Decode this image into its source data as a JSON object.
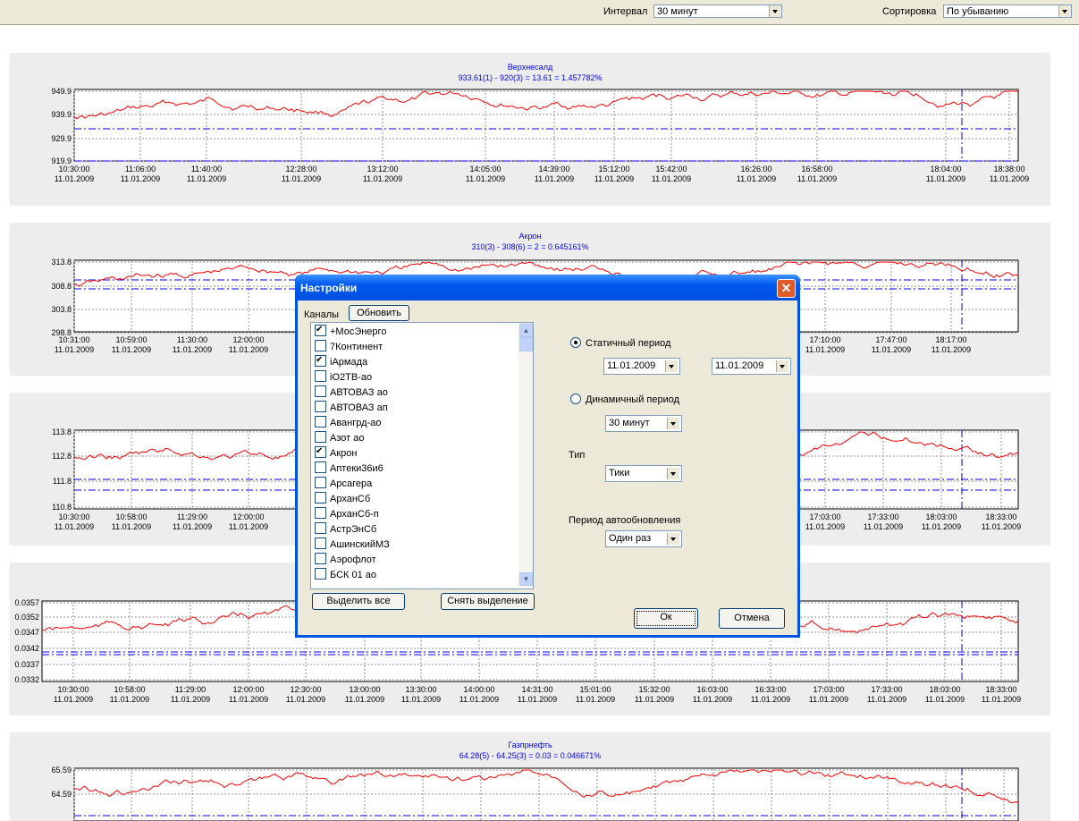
{
  "toolbar": {
    "interval_label": "Интервал",
    "interval_value": "30 минут",
    "sort_label": "Сортировка",
    "sort_value": "По убыванию"
  },
  "charts": [
    {
      "title": "Верхнесалд",
      "subtitle": "933.61(1) - 920(3) = 13.61 = 1.457782%",
      "yticks": [
        "949.9",
        "939.9",
        "929.9",
        "919.9"
      ],
      "xticks": [
        [
          "10:30:00",
          "11.01.2009"
        ],
        [
          "11:06:00",
          "11.01.2009"
        ],
        [
          "11:40:00",
          "11.01.2009"
        ],
        [
          "12:28:00",
          "11.01.2009"
        ],
        [
          "13:12:00",
          "11.01.2009"
        ],
        [
          "14:05:00",
          "11.01.2009"
        ],
        [
          "14:39:00",
          "11.01.2009"
        ],
        [
          "15:12:00",
          "11.01.2009"
        ],
        [
          "15:42:00",
          "11.01.2009"
        ],
        [
          "16:26:00",
          "11.01.2009"
        ],
        [
          "16:58:00",
          "11.01.2009"
        ],
        [
          "18:04:00",
          "11.01.2009"
        ],
        [
          "18:38:00",
          "11.01.2009"
        ]
      ]
    },
    {
      "title": "Акрон",
      "subtitle": "310(3) - 308(6) = 2 = 0.645161%",
      "yticks": [
        "313.8",
        "308.8",
        "303.8",
        "298.8"
      ],
      "xticks": [
        [
          "10:31:00",
          "11.01.2009"
        ],
        [
          "10:59:00",
          "11.01.2009"
        ],
        [
          "11:30:00",
          "11.01.2009"
        ],
        [
          "12:00:00",
          "11.01.2009"
        ],
        [
          "17:10:00",
          "11.01.2009"
        ],
        [
          "17:47:00",
          "11.01.2009"
        ],
        [
          "18:17:00",
          "11.01.2009"
        ]
      ]
    },
    {
      "title": "",
      "subtitle": "",
      "yticks": [
        "113.8",
        "112.8",
        "111.8",
        "110.8"
      ],
      "xticks": [
        [
          "10:30:00",
          "11.01.2009"
        ],
        [
          "10:58:00",
          "11.01.2009"
        ],
        [
          "11:29:00",
          "11.01.2009"
        ],
        [
          "12:00:00",
          "11.01.2009"
        ],
        [
          "17:03:00",
          "11.01.2009"
        ],
        [
          "17:33:00",
          "11.01.2009"
        ],
        [
          "18:03:00",
          "11.01.2009"
        ],
        [
          "18:33:00",
          "11.01.2009"
        ]
      ]
    },
    {
      "title": "",
      "subtitle": "",
      "yticks": [
        "0.0357",
        "0.0352",
        "0.0347",
        "0.0342",
        "0.0337",
        "0.0332"
      ],
      "xticks": [
        [
          "10:30:00",
          "11.01.2009"
        ],
        [
          "10:58:00",
          "11.01.2009"
        ],
        [
          "11:29:00",
          "11.01.2009"
        ],
        [
          "12:00:00",
          "11.01.2009"
        ],
        [
          "12:30:00",
          "11.01.2009"
        ],
        [
          "13:00:00",
          "11.01.2009"
        ],
        [
          "13:30:00",
          "11.01.2009"
        ],
        [
          "14:00:00",
          "11.01.2009"
        ],
        [
          "14:31:00",
          "11.01.2009"
        ],
        [
          "15:01:00",
          "11.01.2009"
        ],
        [
          "15:32:00",
          "11.01.2009"
        ],
        [
          "16:03:00",
          "11.01.2009"
        ],
        [
          "16:33:00",
          "11.01.2009"
        ],
        [
          "17:03:00",
          "11.01.2009"
        ],
        [
          "17:33:00",
          "11.01.2009"
        ],
        [
          "18:03:00",
          "11.01.2009"
        ],
        [
          "18:33:00",
          "11.01.2009"
        ]
      ]
    },
    {
      "title": "Газпрнефть",
      "subtitle": "64.28(5) - 64.25(3) = 0.03 = 0.046671%",
      "yticks": [
        "65.59",
        "64.59"
      ],
      "xticks": []
    }
  ],
  "dialog": {
    "title": "Настройки",
    "channels_label": "Каналы",
    "refresh_button": "Обновить",
    "channels": [
      {
        "label": "+МосЭнерго",
        "checked": true
      },
      {
        "label": "7Континент",
        "checked": false
      },
      {
        "label": "iАрмада",
        "checked": true
      },
      {
        "label": "iO2TB-ao",
        "checked": false
      },
      {
        "label": "АВТОВАЗ ао",
        "checked": false
      },
      {
        "label": "АВТОВАЗ ап",
        "checked": false
      },
      {
        "label": "Авангрд-ао",
        "checked": false
      },
      {
        "label": "Азот ао",
        "checked": false
      },
      {
        "label": "Акрон",
        "checked": true
      },
      {
        "label": "Аптеки36и6",
        "checked": false
      },
      {
        "label": "Арсагера",
        "checked": false
      },
      {
        "label": "АрханСб",
        "checked": false
      },
      {
        "label": "АрханСб-п",
        "checked": false
      },
      {
        "label": "АстрЭнСб",
        "checked": false
      },
      {
        "label": "АшинскийМЗ",
        "checked": false
      },
      {
        "label": "Аэрофлот",
        "checked": false
      },
      {
        "label": "БСК 01 ао",
        "checked": false
      }
    ],
    "select_all_button": "Выделить все",
    "deselect_button": "Снять выделение",
    "static_period_label": "Статичный период",
    "date_from": "11.01.2009",
    "date_to": "11.01.2009",
    "dynamic_period_label": "Динамичный период",
    "dynamic_period_value": "30 минут",
    "type_label": "Тип",
    "type_value": "Тики",
    "autoupdate_label": "Период автообновления",
    "autoupdate_value": "Один раз",
    "ok_button": "Ок",
    "cancel_button": "Отмена"
  }
}
